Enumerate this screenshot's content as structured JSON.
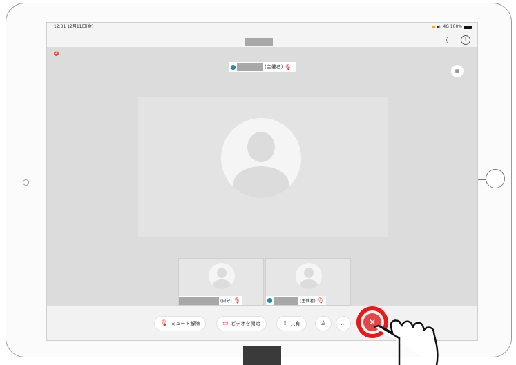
{
  "status_bar": {
    "time": "12:31",
    "date": "12月11日(金)",
    "network": "4G",
    "battery": "100%"
  },
  "header": {
    "bluetooth_icon": "bluetooth-icon",
    "info_icon": "info-icon"
  },
  "notification": {
    "count": "2"
  },
  "main_speaker": {
    "role_label": "(主催者)"
  },
  "thumbnails": [
    {
      "role_label": "(自分)"
    },
    {
      "role_label": "(主催者)"
    }
  ],
  "toolbar": {
    "unmute_label": "ミュート解除",
    "start_video_label": "ビデオを開始",
    "share_label": "共有",
    "more_label": "…",
    "leave_icon": "close-icon"
  },
  "colors": {
    "leave_red": "#e31b1b",
    "mic_red": "#d9302c",
    "presence_teal": "#1a9e8c"
  }
}
